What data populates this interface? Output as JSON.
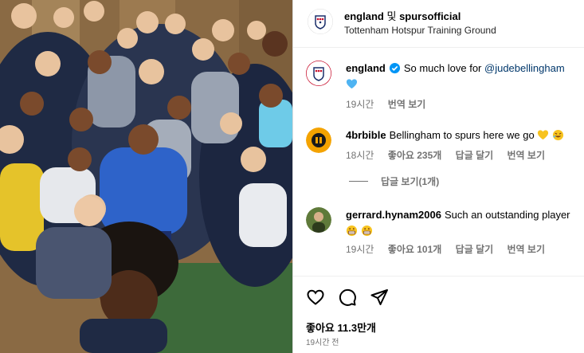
{
  "header": {
    "account": "england",
    "connector": "및",
    "collaborator": "spursofficial",
    "location": "Tottenham Hotspur Training Ground"
  },
  "caption": {
    "user": "england",
    "verified": true,
    "text": "So much love for",
    "mention": "@judebellingham",
    "emoji_icon": "blue-heart-icon",
    "time": "19시간",
    "translate": "번역 보기"
  },
  "comments": [
    {
      "user": "4brbible",
      "text": "Bellingham to spurs here we go",
      "emoji_icons": [
        "yellow-heart-icon",
        "rolling-laughing-icon"
      ],
      "time": "18시간",
      "likes": "좋아요 235개",
      "reply": "답글 달기",
      "translate": "번역 보기"
    },
    {
      "user": "gerrard.hynam2006",
      "text": "Such an outstanding player",
      "emoji_icons": [
        "grimacing-face-icon",
        "grimacing-face-icon"
      ],
      "time": "19시간",
      "likes": "좋아요 101개",
      "reply": "답글 달기",
      "translate": "번역 보기"
    }
  ],
  "view_replies": "답글 보기(1개)",
  "actions": [
    "heart-icon",
    "comment-icon",
    "share-icon"
  ],
  "likes_total": "좋아요 11.3만개",
  "posted": "19시간 전",
  "colors": {
    "mention": "#00376b",
    "verified": "#0095f6",
    "meta": "#737373",
    "border": "#dbdbdb"
  }
}
